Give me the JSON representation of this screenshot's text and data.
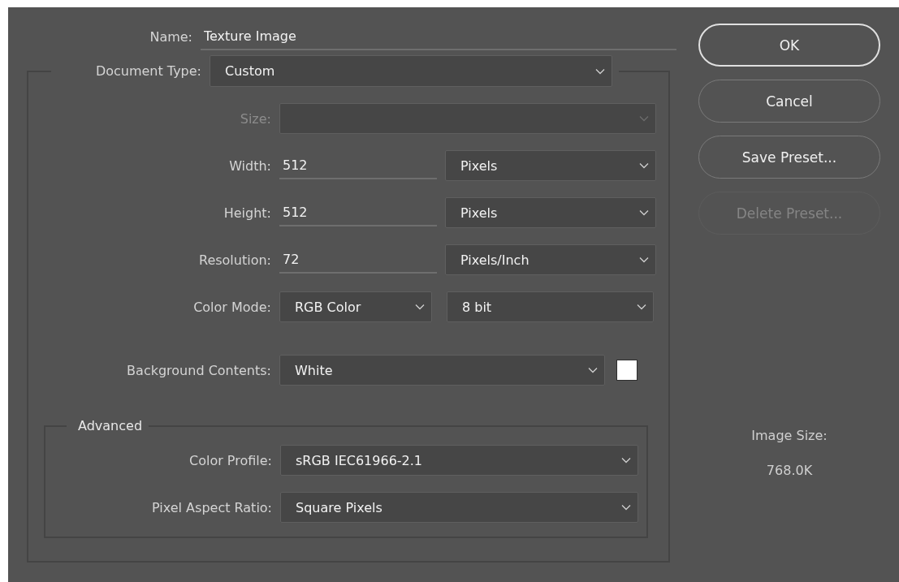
{
  "name": {
    "label": "Name:",
    "value": "Texture Image"
  },
  "document_type": {
    "label": "Document Type:",
    "value": "Custom"
  },
  "size": {
    "label": "Size:",
    "disabled": true
  },
  "fields": [
    {
      "label": "Width:",
      "value": "512",
      "unit": "Pixels"
    },
    {
      "label": "Height:",
      "value": "512",
      "unit": "Pixels"
    },
    {
      "label": "Resolution:",
      "value": "72",
      "unit": "Pixels/Inch"
    }
  ],
  "color_mode": {
    "label": "Color Mode:",
    "mode": "RGB Color",
    "depth": "8 bit"
  },
  "background": {
    "label": "Background Contents:",
    "value": "White",
    "color": "#ffffff"
  },
  "advanced": {
    "title": "Advanced",
    "rows": [
      {
        "label": "Color Profile:",
        "value": "sRGB IEC61966-2.1"
      },
      {
        "label": "Pixel Aspect Ratio:",
        "value": "Square Pixels"
      }
    ]
  },
  "buttons": [
    {
      "label": "OK",
      "default": true,
      "disabled": false
    },
    {
      "label": "Cancel",
      "default": false,
      "disabled": false
    },
    {
      "label": "Save Preset...",
      "default": false,
      "disabled": false
    },
    {
      "label": "Delete Preset...",
      "default": false,
      "disabled": true
    }
  ],
  "image_size": {
    "label": "Image Size:",
    "value": "768.0K"
  }
}
